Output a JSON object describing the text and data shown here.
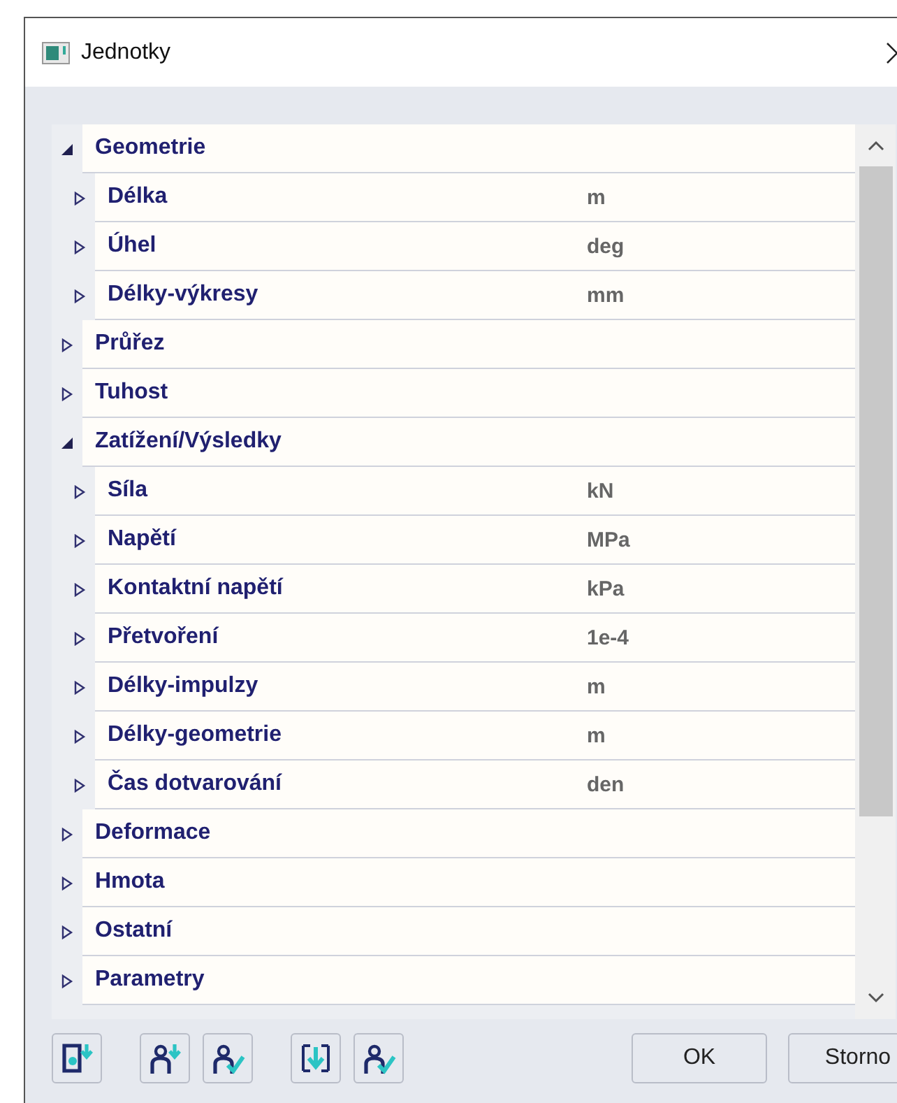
{
  "window": {
    "title": "Jednotky"
  },
  "tree": [
    {
      "label": "Geometrie",
      "expanded": true,
      "children": [
        {
          "label": "Délka",
          "value": "m",
          "expanded": false
        },
        {
          "label": "Úhel",
          "value": "deg",
          "expanded": false
        },
        {
          "label": "Délky-výkresy",
          "value": "mm",
          "expanded": false
        }
      ]
    },
    {
      "label": "Průřez",
      "expanded": false
    },
    {
      "label": "Tuhost",
      "expanded": false
    },
    {
      "label": "Zatížení/Výsledky",
      "expanded": true,
      "children": [
        {
          "label": "Síla",
          "value": "kN",
          "expanded": false
        },
        {
          "label": "Napětí",
          "value": "MPa",
          "expanded": false
        },
        {
          "label": "Kontaktní napětí",
          "value": "kPa",
          "expanded": false
        },
        {
          "label": "Přetvoření",
          "value": "1e-4",
          "expanded": false
        },
        {
          "label": "Délky-impulzy",
          "value": "m",
          "expanded": false
        },
        {
          "label": "Délky-geometrie",
          "value": "m",
          "expanded": false
        },
        {
          "label": "Čas dotvarování",
          "value": "den",
          "expanded": false
        }
      ]
    },
    {
      "label": "Deformace",
      "expanded": false
    },
    {
      "label": "Hmota",
      "expanded": false
    },
    {
      "label": "Ostatní",
      "expanded": false
    },
    {
      "label": "Parametry",
      "expanded": false
    }
  ],
  "dialog_buttons": [
    "OK",
    "Storno"
  ]
}
